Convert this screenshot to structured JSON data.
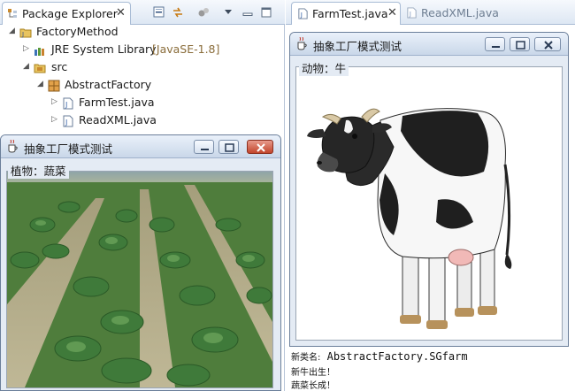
{
  "package_explorer": {
    "tab_label": "Package Explorer",
    "tree": [
      {
        "label": "FactoryMethod",
        "type": "project",
        "expanded": true
      },
      {
        "label": "JRE System Library",
        "suffix": "[JavaSE-1.8]",
        "type": "library",
        "expanded": false
      },
      {
        "label": "src",
        "type": "folder",
        "expanded": true
      },
      {
        "label": "AbstractFactory",
        "type": "package",
        "expanded": true
      },
      {
        "label": "FarmTest.java",
        "type": "java-file",
        "expanded": false
      },
      {
        "label": "ReadXML.java",
        "type": "java-file",
        "expanded": false
      }
    ]
  },
  "editor": {
    "tabs": [
      {
        "label": "FarmTest.java",
        "active": true
      },
      {
        "label": "ReadXML.java",
        "active": false
      }
    ]
  },
  "plant_window": {
    "title": "抽象工厂模式测试",
    "panel_label": "植物：蔬菜",
    "image": "cabbage-field"
  },
  "animal_window": {
    "title": "抽象工厂模式测试",
    "panel_label": "动物：牛",
    "image": "cow"
  },
  "console": {
    "lines": [
      {
        "prefix": "新类名:",
        "value": "AbstractFactory.SGfarm"
      },
      {
        "prefix": "新牛出生！",
        "value": ""
      },
      {
        "prefix": "蔬菜长成！",
        "value": ""
      }
    ]
  },
  "colors": {
    "tab_gradient_top": "#f6f9fd",
    "tab_gradient_bottom": "#dde7f3",
    "window_bg": "#e4ebf4",
    "close_button": "#c2452b",
    "library_suffix": "#8a6d3b"
  }
}
